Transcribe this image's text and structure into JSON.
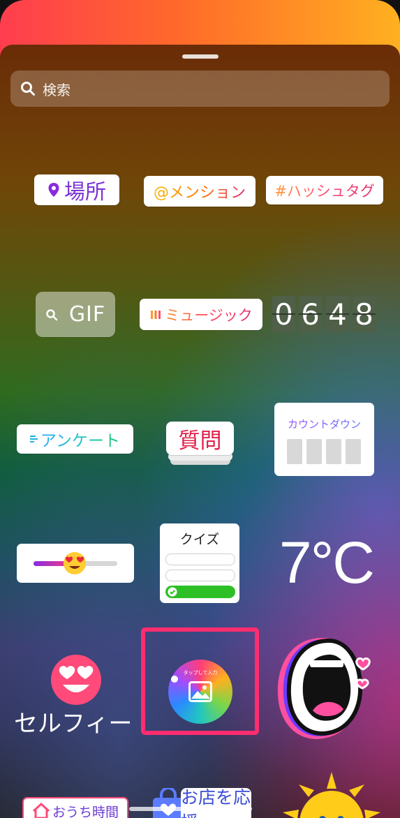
{
  "search": {
    "placeholder": "検索"
  },
  "stickers": {
    "location": "場所",
    "mention": "@メンション",
    "hashtag": "#ハッシュタグ",
    "gif": "GIF",
    "music": "ミュージック",
    "clock_digits": [
      "0",
      "6",
      "4",
      "8"
    ],
    "poll": "アンケート",
    "questions": "質問",
    "countdown": "カウントダウン",
    "quiz": "クイズ",
    "temperature": "7°C",
    "selfie": "セルフィー",
    "add_yours_hint": "タップして入力",
    "stay_home": "おうち時間",
    "support_small_business": "お店を応援"
  },
  "colors": {
    "highlight": "#ff2d6f",
    "location": "#8a2be2",
    "poll": "#1bb6e8",
    "questions": "#e0204a"
  }
}
